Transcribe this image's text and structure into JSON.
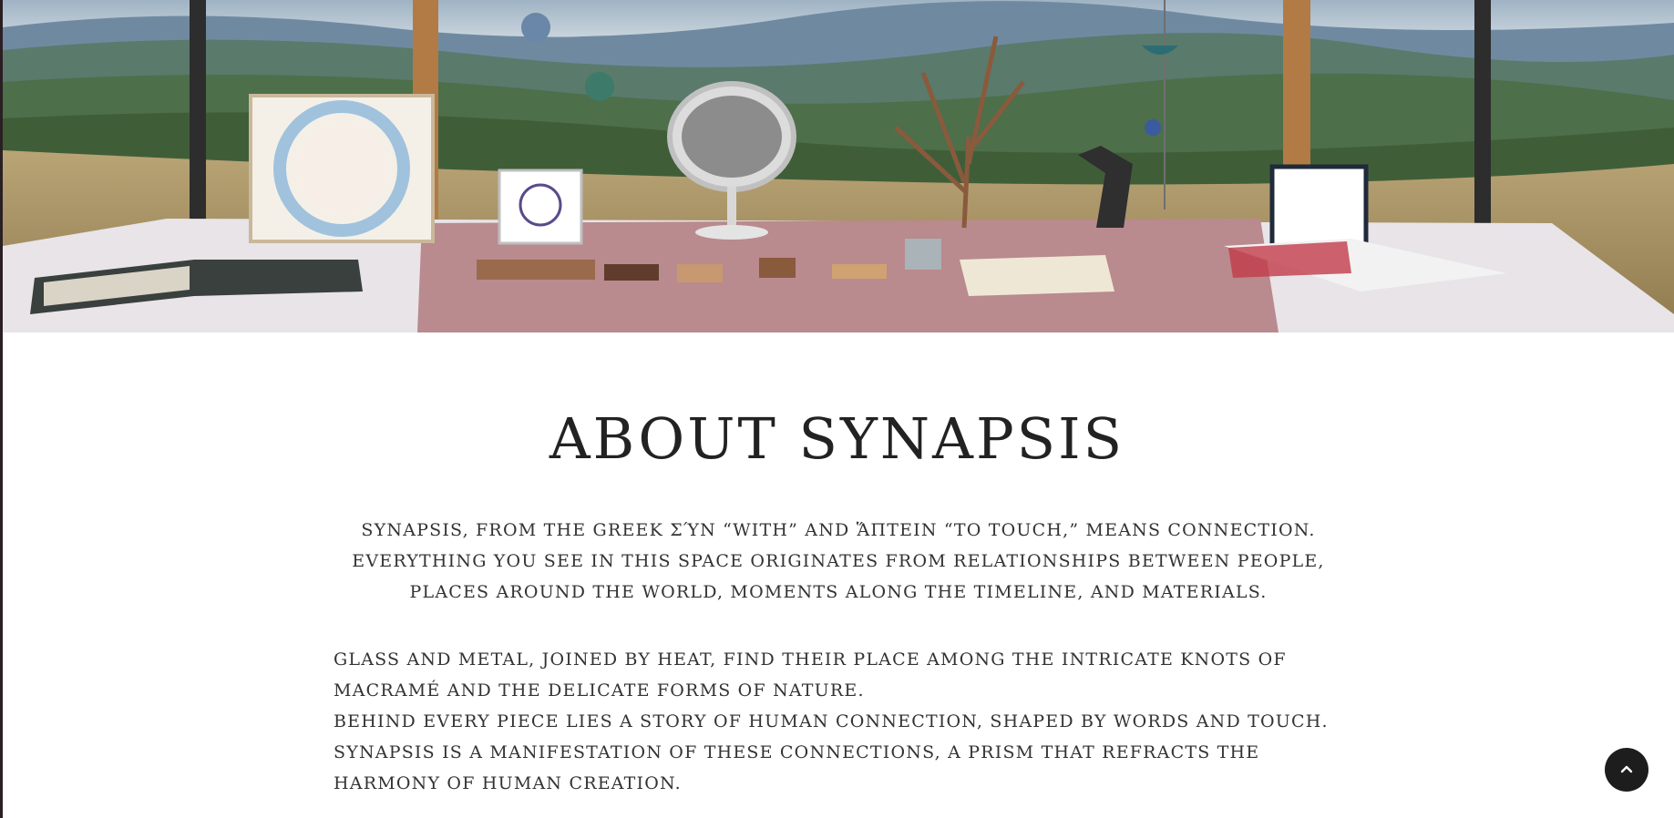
{
  "hero": {
    "image_description_icon": "hero-photo"
  },
  "about": {
    "title": "ABOUT SYNAPSIS",
    "intro": "SYNAPSIS, FROM THE GREEK σύν “WITH” AND ἅπτειν “TO TOUCH,” MEANS CONNECTION. EVERYTHING YOU SEE IN THIS SPACE ORIGINATES FROM RELATIONSHIPS BETWEEN PEOPLE, PLACES AROUND THE WORLD, MOMENTS ALONG THE TIMELINE, AND MATERIALS.",
    "paragraphs": [
      "GLASS AND METAL, JOINED BY HEAT, FIND THEIR PLACE AMONG THE INTRICATE KNOTS OF MACRAMÉ AND THE DELICATE FORMS OF NATURE.",
      "BEHIND EVERY PIECE LIES A STORY OF HUMAN CONNECTION, SHAPED BY WORDS AND TOUCH.",
      "SYNAPSIS IS A MANIFESTATION OF THESE CONNECTIONS, A PRISM THAT REFRACTS THE HARMONY OF HUMAN CREATION."
    ]
  },
  "scroll_top": {
    "icon": "chevron-up-icon"
  },
  "colors": {
    "text": "#333333",
    "title": "#222222",
    "button": "#1d1d1d",
    "tablecloth": "#b98a8e"
  }
}
